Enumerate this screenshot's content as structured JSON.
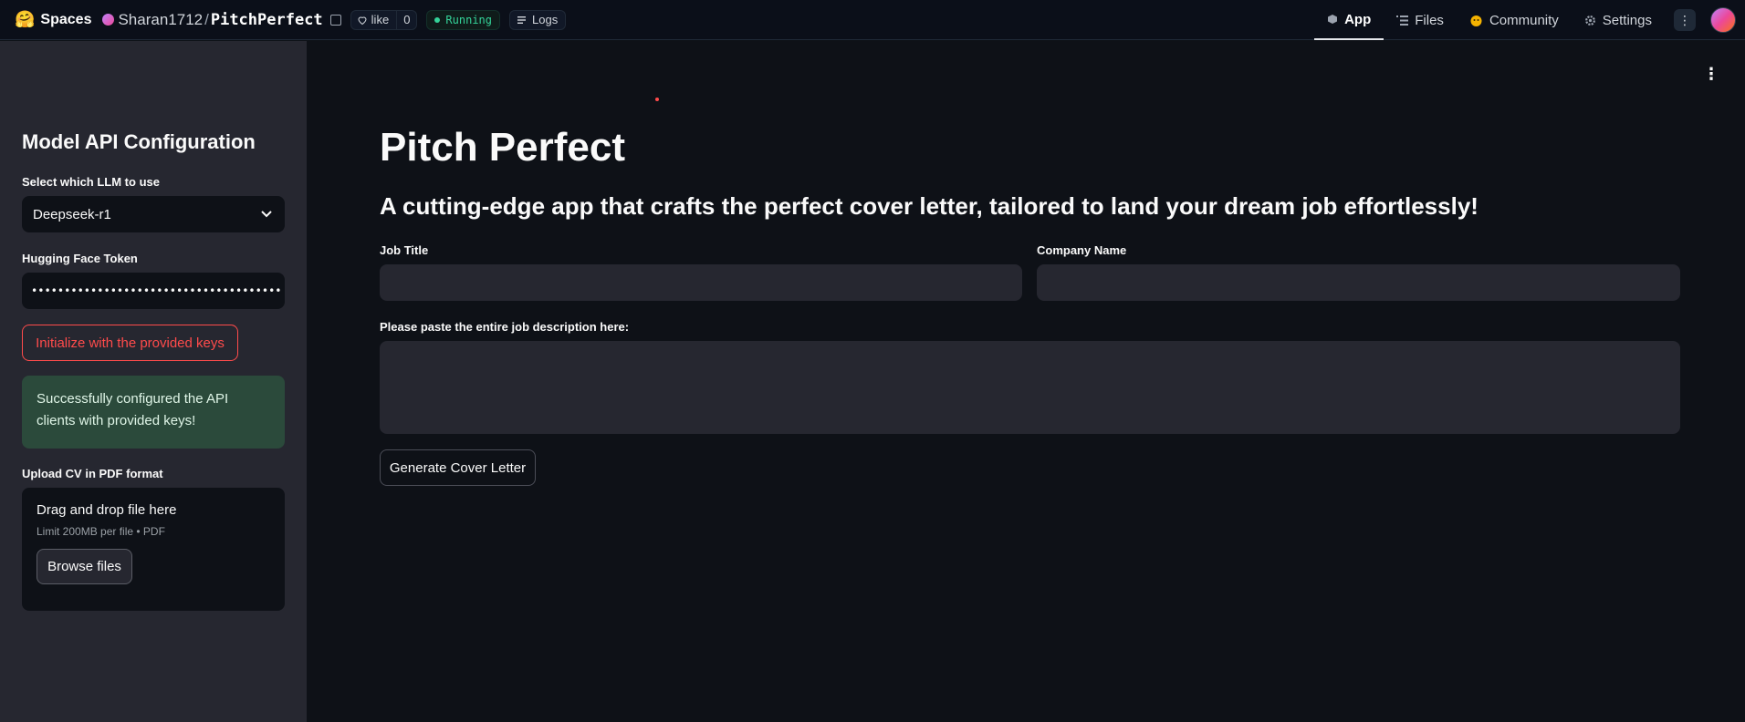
{
  "topbar": {
    "logo_emoji": "🤗",
    "brand": "Spaces",
    "owner": "Sharan1712",
    "slash": "/",
    "repo": "PitchPerfect",
    "like_label": "like",
    "like_count": "0",
    "status": "Running",
    "logs": "Logs",
    "tabs": [
      {
        "label": "App",
        "icon": "cube-icon"
      },
      {
        "label": "Files",
        "icon": "files-icon"
      },
      {
        "label": "Community",
        "icon": "community-icon"
      },
      {
        "label": "Settings",
        "icon": "gear-icon"
      }
    ],
    "more": "⋮"
  },
  "sidebar": {
    "title": "Model API Configuration",
    "llm_label": "Select which LLM to use",
    "llm_value": "Deepseek-r1",
    "token_label": "Hugging Face Token",
    "token_value": "••••••••••••••••••••••••••••••••••••••",
    "init_button": "Initialize with the provided keys",
    "success_message": "Successfully configured the API clients with provided keys!",
    "upload_label": "Upload CV in PDF format",
    "upload_title": "Drag and drop file here",
    "upload_limit": "Limit 200MB per file • PDF",
    "browse_button": "Browse files"
  },
  "main": {
    "title": "Pitch Perfect",
    "subtitle": "A cutting-edge app that crafts the perfect cover letter, tailored to land your dream job effortlessly!",
    "job_title_label": "Job Title",
    "company_label": "Company Name",
    "description_label": "Please paste the entire job description here:",
    "generate_button": "Generate Cover Letter"
  },
  "colors": {
    "accent_red": "#ff4b4b",
    "success_bg": "#2b4a3b",
    "running_green": "#34d399"
  }
}
